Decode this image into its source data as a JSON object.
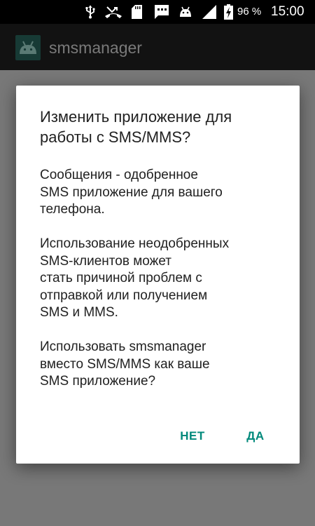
{
  "status_bar": {
    "icons": [
      "usb-icon",
      "missed-call-icon",
      "sd-card-icon",
      "message-icon",
      "android-debug-icon",
      "signal-icon",
      "battery-charging-icon"
    ],
    "battery_percent": "96 %",
    "time": "15:00"
  },
  "app_bar": {
    "title": "smsmanager",
    "icon": "android-app-icon"
  },
  "dialog": {
    "title": "Изменить приложение для работы с SMS/MMS?",
    "message": "Сообщения - одобренное\nSMS приложение для вашего\nтелефона.\n\n Использование неодобренных\nSMS-клиентов может\nстать причиной проблем с\nотправкой или получением\nSMS и MMS.\n\nИспользовать smsmanager\nвместо SMS/MMS как ваше\nSMS приложение?",
    "buttons": {
      "negative": "НЕТ",
      "positive": "ДА"
    }
  },
  "colors": {
    "accent": "#00897b",
    "scrim": "#787878",
    "app_icon_bg": "#173a35"
  }
}
